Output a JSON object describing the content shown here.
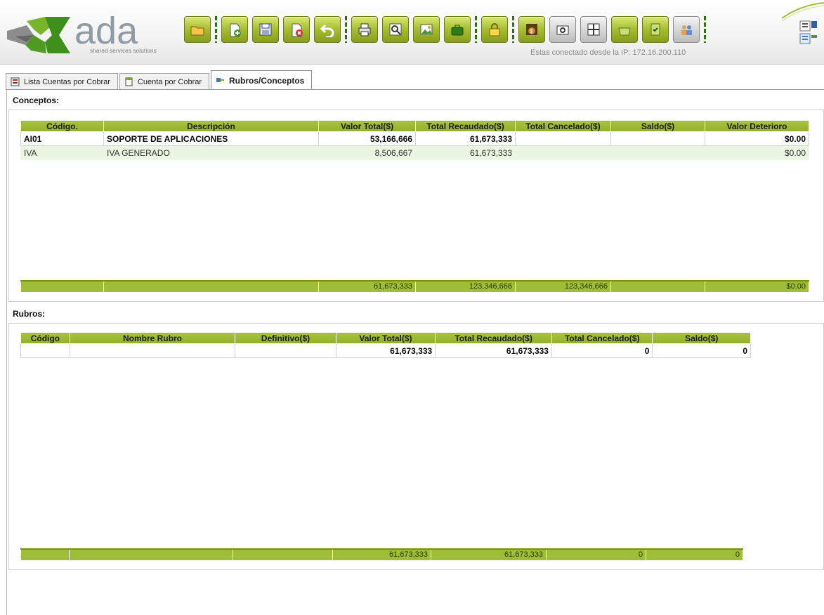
{
  "header": {
    "logo_text": "ada",
    "logo_subtitle": "shared services solutions",
    "ip_text": "Estas conectado desde la IP: 172.16.200.110",
    "toolbar": [
      {
        "icon": "folder-icon",
        "style": "green"
      },
      {
        "sep": true
      },
      {
        "icon": "add-document-icon",
        "style": "green"
      },
      {
        "icon": "save-icon",
        "style": "green"
      },
      {
        "icon": "delete-icon",
        "style": "green"
      },
      {
        "icon": "undo-icon",
        "style": "green"
      },
      {
        "sep": true
      },
      {
        "icon": "print-icon",
        "style": "green"
      },
      {
        "icon": "preview-icon",
        "style": "green"
      },
      {
        "icon": "export-image-icon",
        "style": "green"
      },
      {
        "icon": "briefcase-icon",
        "style": "green"
      },
      {
        "sep": true
      },
      {
        "icon": "lock-icon",
        "style": "green"
      },
      {
        "sep": true
      },
      {
        "icon": "money-bag-icon",
        "style": "green"
      },
      {
        "icon": "camera-icon",
        "style": "gray"
      },
      {
        "icon": "grid-icon",
        "style": "gray"
      },
      {
        "icon": "basket-icon",
        "style": "green"
      },
      {
        "icon": "checklist-icon",
        "style": "green"
      },
      {
        "icon": "users-icon",
        "style": "gray"
      },
      {
        "sep": true
      }
    ]
  },
  "tabs": [
    {
      "label": "Lista Cuentas por Cobrar",
      "icon": "list-icon",
      "active": false
    },
    {
      "label": "Cuenta por Cobrar",
      "icon": "document-icon",
      "active": false
    },
    {
      "label": "Rubros/Conceptos",
      "icon": "link-icon",
      "active": true
    }
  ],
  "conceptos": {
    "label": "Conceptos:",
    "columns": [
      "Código.",
      "Descripción",
      "Valor Total($)",
      "Total Recaudado($)",
      "Total Cancelado($)",
      "Saldo($)",
      "Valor Deterioro"
    ],
    "rows": [
      [
        "AI01",
        "SOPORTE DE APLICACIONES",
        "53,166,666",
        "61,673,333",
        "",
        "",
        "$0.00"
      ],
      [
        "IVA",
        "IVA GENERADO",
        "8,506,667",
        "61,673,333",
        "",
        "",
        "$0.00"
      ]
    ],
    "totals": [
      "",
      "",
      "61,673,333",
      "123,346,666",
      "123,346,666",
      "",
      "$0.00"
    ]
  },
  "rubros": {
    "label": "Rubros:",
    "columns": [
      "Código",
      "Nombre Rubro",
      "Definitivo($)",
      "Valor Total($)",
      "Total Recaudado($)",
      "Total Cancelado($)",
      "Saldo($)"
    ],
    "rows": [
      [
        "",
        "",
        "",
        "61,673,333",
        "61,673,333",
        "0",
        "0"
      ]
    ],
    "totals": [
      "",
      "",
      "",
      "61,673,333",
      "61,673,333",
      "0",
      "0"
    ]
  },
  "colors": {
    "accent_green": "#9fbe37",
    "row_alt": "#eaf6e2",
    "ip_text": "#8a8a8a"
  }
}
